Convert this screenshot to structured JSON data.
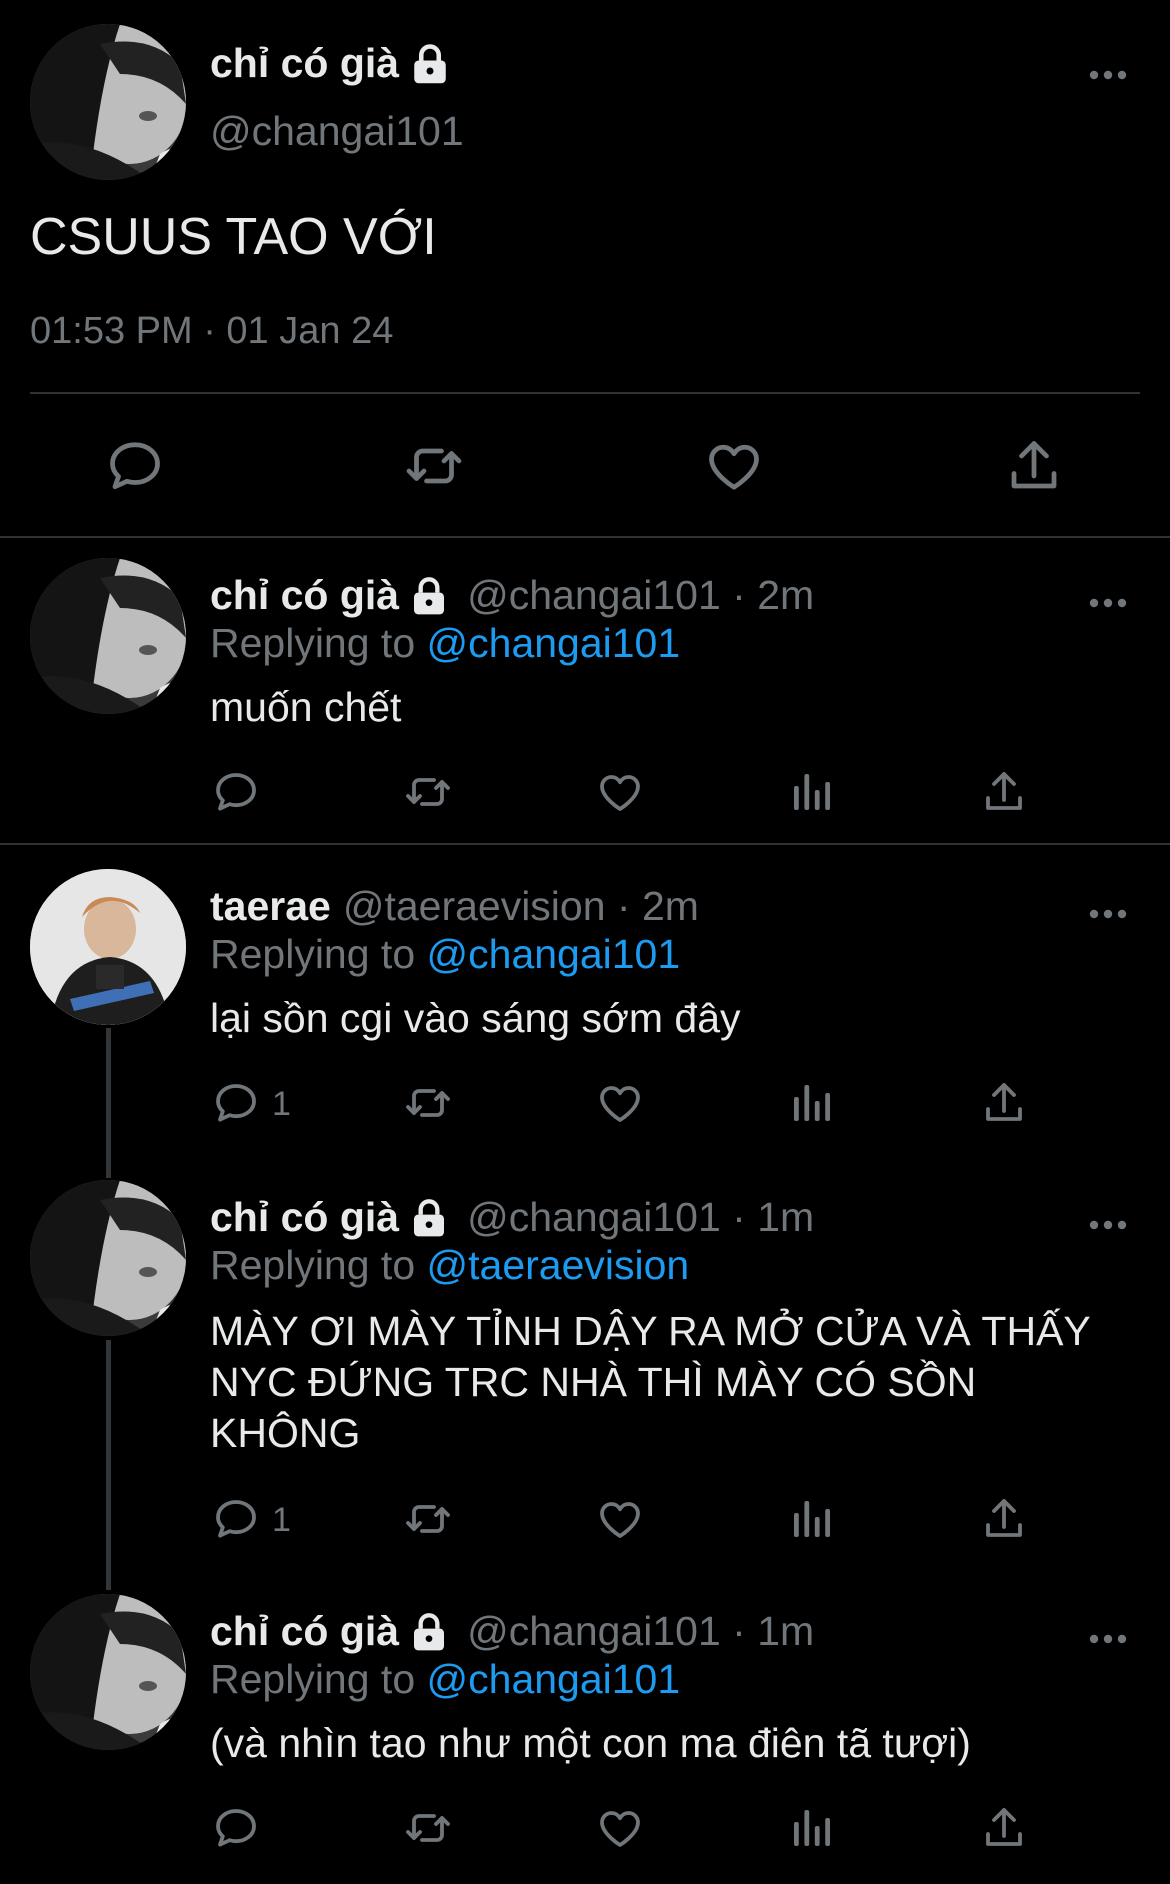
{
  "main_tweet": {
    "name": "chỉ có già",
    "handle": "@changai101",
    "text": "CSUUS TAO VỚI",
    "timestamp": "01:53 PM · 01 Jan 24",
    "actions": [
      "reply-icon",
      "retweet-icon",
      "like-icon",
      "share-icon"
    ]
  },
  "replies": [
    {
      "name": "chỉ có già",
      "locked": true,
      "handle": "@changai101 · 2m",
      "replying_prefix": "Replying to ",
      "replying_to": "@changai101",
      "body": "muốn chết",
      "reply_count": ""
    },
    {
      "name": "taerae",
      "locked": false,
      "handle": "@taeraevision · 2m",
      "replying_prefix": "Replying to ",
      "replying_to": "@changai101",
      "body": "lại sồn cgi vào sáng sớm đây",
      "reply_count": "1"
    },
    {
      "name": "chỉ có già",
      "locked": true,
      "handle": "@changai101 · 1m",
      "replying_prefix": "Replying to ",
      "replying_to": "@taeraevision",
      "body": "MÀY ƠI MÀY TỈNH DẬY RA MỞ CỬA VÀ THẤY NYC ĐỨNG TRC NHÀ THÌ MÀY CÓ SỒN KHÔNG",
      "reply_count": "1"
    },
    {
      "name": "chỉ có già",
      "locked": true,
      "handle": "@changai101 · 1m",
      "replying_prefix": "Replying to ",
      "replying_to": "@changai101",
      "body": "(và nhìn tao như một con ma điên tã tượi)",
      "reply_count": ""
    }
  ],
  "colors": {
    "background": "#000000",
    "text": "#e7e9ea",
    "muted": "#71767b",
    "link": "#1d9bf0",
    "divider": "#2f3336"
  }
}
